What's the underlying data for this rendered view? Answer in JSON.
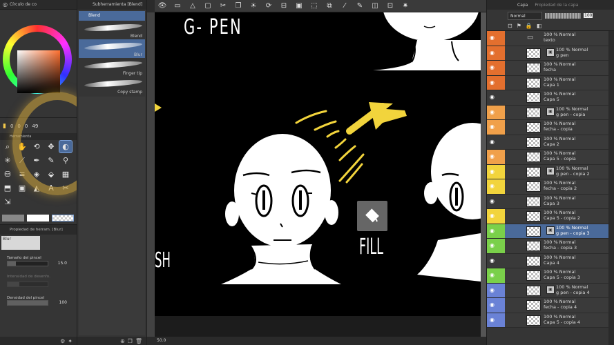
{
  "color_panel": {
    "tab_label": "Círculo de co",
    "readout": [
      "0",
      "0",
      "0",
      "49"
    ]
  },
  "tool_panel": {
    "header": "Herramienta"
  },
  "props_panel": {
    "header": "Propiedad de herram. [Blur]",
    "sub_label": "Blur",
    "brush_size_label": "Tamaño del pincel",
    "brush_size_value": "15.0",
    "dim_label": "Intensidad de desenfo.",
    "density_label": "Densidad del pincel",
    "density_value": "100"
  },
  "subtool": {
    "header": "Subherramienta [Blend]",
    "tab": "Blend",
    "brushes": [
      {
        "label": "Blend"
      },
      {
        "label": "Blur"
      },
      {
        "label": "Finger tip"
      },
      {
        "label": "Copy stamp"
      }
    ]
  },
  "canvas": {
    "gpen_text": "G- PEN",
    "fill_text": "FILL",
    "brush_partial_text": "SH"
  },
  "status": {
    "zoom": "50.0"
  },
  "layers": {
    "tab_label": "Capa",
    "tab_props": "Propiedad de la capa",
    "blend_mode": "Normal",
    "opacity": "100",
    "rows": [
      {
        "color": "#e36f2e",
        "line1": "100 % Normal",
        "line2": "texto",
        "folder": true
      },
      {
        "color": "#e36f2e",
        "line1": "100 % Normal",
        "line2": "g pen",
        "mask": true
      },
      {
        "color": "#e36f2e",
        "line1": "100 % Normal",
        "line2": "fecha"
      },
      {
        "color": "#e36f2e",
        "line1": "100 % Normal",
        "line2": "Capa 1"
      },
      {
        "color": "#3a3a3a",
        "line1": "100 % Normal",
        "line2": "Capa 5"
      },
      {
        "color": "#f0a04a",
        "line1": "100 % Normal",
        "line2": "g pen - copia",
        "mask": true
      },
      {
        "color": "#f0a04a",
        "line1": "100 % Normal",
        "line2": "fecha - copia"
      },
      {
        "color": "#3a3a3a",
        "line1": "100 % Normal",
        "line2": "Capa 2"
      },
      {
        "color": "#f0a04a",
        "line1": "100 % Normal",
        "line2": "Capa 5 - copia"
      },
      {
        "color": "#f2d43c",
        "line1": "100 % Normal",
        "line2": "g pen - copia 2",
        "mask": true
      },
      {
        "color": "#f2d43c",
        "line1": "100 % Normal",
        "line2": "fecha - copia 2"
      },
      {
        "color": "#3a3a3a",
        "line1": "100 % Normal",
        "line2": "Capa 3"
      },
      {
        "color": "#f2d43c",
        "line1": "100 % Normal",
        "line2": "Capa 5 - copia 2"
      },
      {
        "color": "#7ad04a",
        "line1": "100 % Normal",
        "line2": "g pen - copia 3",
        "mask": true,
        "selected": true
      },
      {
        "color": "#7ad04a",
        "line1": "100 % Normal",
        "line2": "fecha - copia 3"
      },
      {
        "color": "#3a3a3a",
        "line1": "100 % Normal",
        "line2": "Capa 4"
      },
      {
        "color": "#7ad04a",
        "line1": "100 % Normal",
        "line2": "Capa 5 - copia 3"
      },
      {
        "color": "#6a82d6",
        "line1": "100 % Normal",
        "line2": "g pen - copia 4",
        "mask": true
      },
      {
        "color": "#6a82d6",
        "line1": "100 % Normal",
        "line2": "fecha - copia 4"
      },
      {
        "color": "#6a82d6",
        "line1": "100 % Normal",
        "line2": "Capa 5 - copia 4"
      }
    ]
  }
}
